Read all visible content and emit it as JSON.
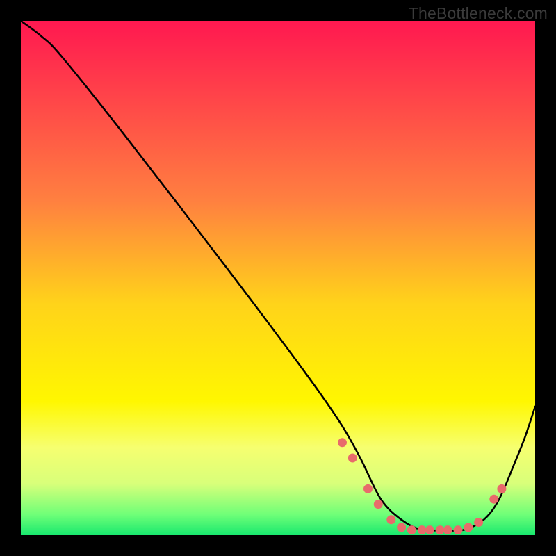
{
  "watermark": "TheBottleneck.com",
  "chart_data": {
    "type": "line",
    "title": "",
    "xlabel": "",
    "ylabel": "",
    "xlim": [
      0,
      100
    ],
    "ylim": [
      0,
      100
    ],
    "grid": false,
    "background_gradient": {
      "stops": [
        {
          "offset": 0.0,
          "color": "#ff1850"
        },
        {
          "offset": 0.35,
          "color": "#ff8040"
        },
        {
          "offset": 0.55,
          "color": "#ffd31a"
        },
        {
          "offset": 0.74,
          "color": "#fff700"
        },
        {
          "offset": 0.83,
          "color": "#f6ff70"
        },
        {
          "offset": 0.9,
          "color": "#d8ff7a"
        },
        {
          "offset": 0.96,
          "color": "#6fff78"
        },
        {
          "offset": 1.0,
          "color": "#18e86e"
        }
      ]
    },
    "series": [
      {
        "name": "curve",
        "color": "#000000",
        "x": [
          0,
          4,
          8,
          20,
          40,
          55,
          62,
          66,
          70,
          74,
          78,
          82,
          86,
          90,
          93,
          96,
          98,
          100
        ],
        "y": [
          100,
          97,
          93,
          78,
          52,
          32,
          22,
          15,
          7,
          3,
          1,
          1,
          1,
          3,
          7,
          14,
          19,
          25
        ]
      }
    ],
    "markers": {
      "name": "dots",
      "color": "#e86b6b",
      "radius": 6.5,
      "points": [
        {
          "x": 62.5,
          "y": 18
        },
        {
          "x": 64.5,
          "y": 15
        },
        {
          "x": 67.5,
          "y": 9
        },
        {
          "x": 69.5,
          "y": 6
        },
        {
          "x": 72.0,
          "y": 3
        },
        {
          "x": 74.0,
          "y": 1.5
        },
        {
          "x": 76.0,
          "y": 1
        },
        {
          "x": 78.0,
          "y": 1
        },
        {
          "x": 79.5,
          "y": 1
        },
        {
          "x": 81.5,
          "y": 1
        },
        {
          "x": 83.0,
          "y": 1
        },
        {
          "x": 85.0,
          "y": 1
        },
        {
          "x": 87.0,
          "y": 1.5
        },
        {
          "x": 89.0,
          "y": 2.5
        },
        {
          "x": 92.0,
          "y": 7
        },
        {
          "x": 93.5,
          "y": 9
        }
      ]
    }
  }
}
